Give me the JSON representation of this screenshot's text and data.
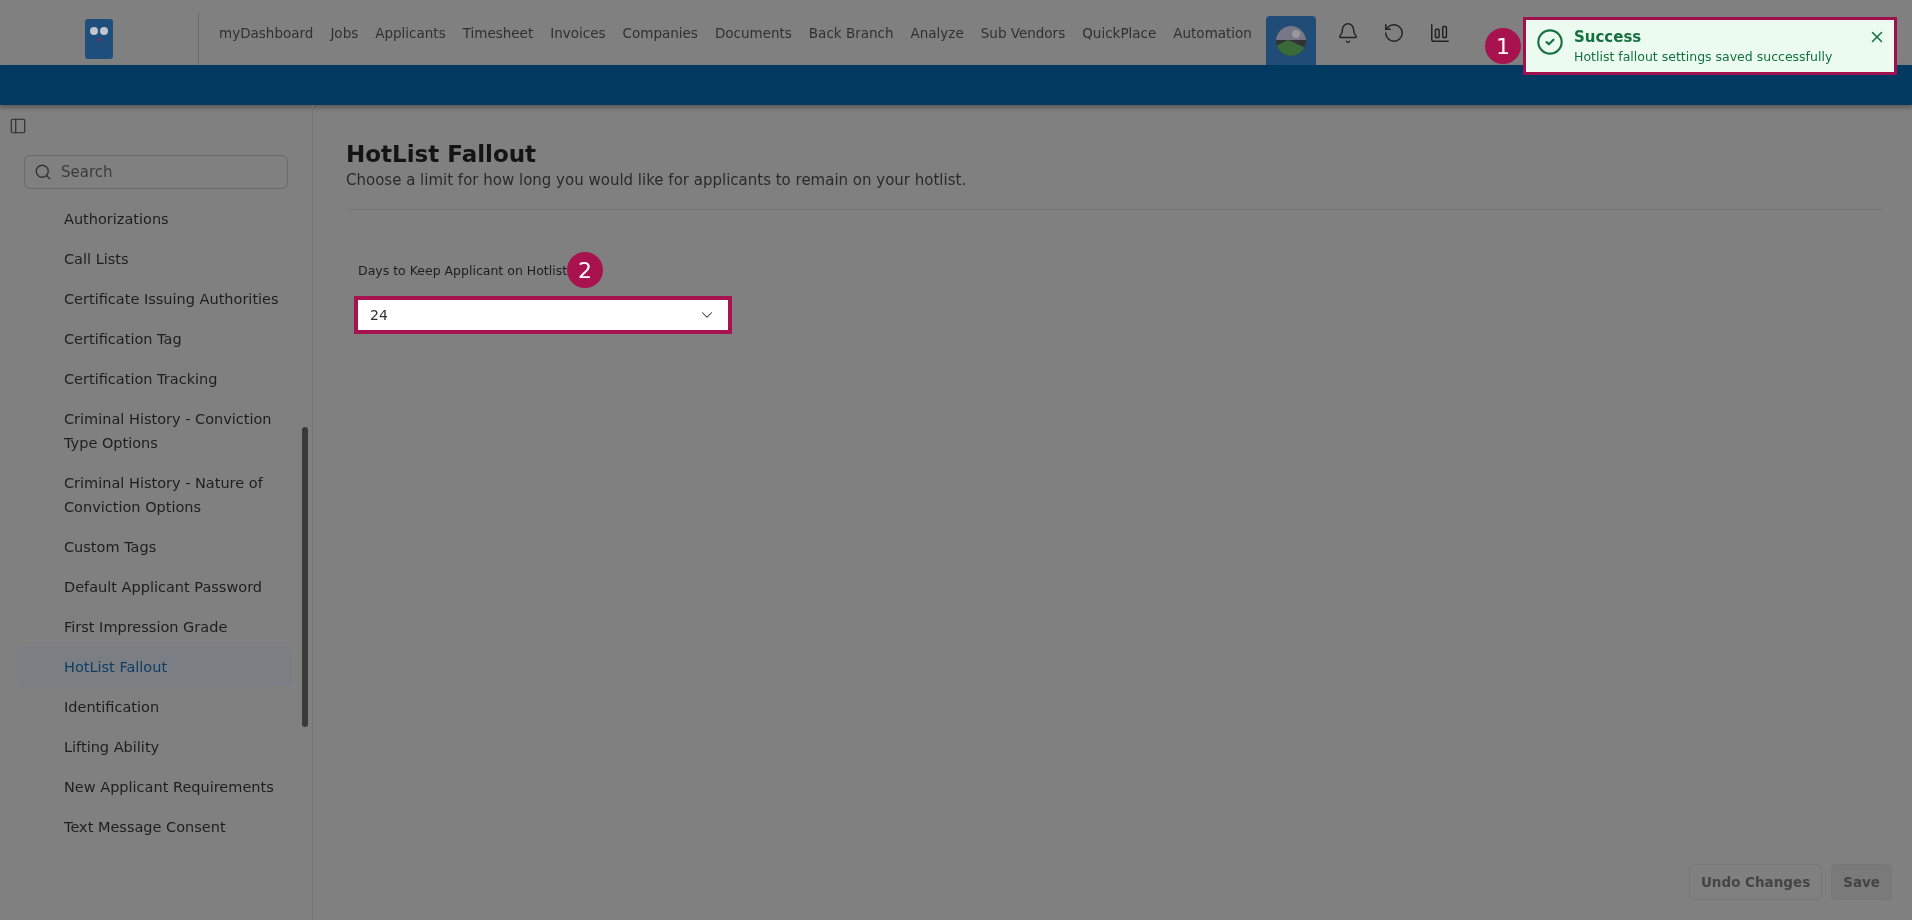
{
  "nav": {
    "items": [
      {
        "label": "myDashboard"
      },
      {
        "label": "Jobs"
      },
      {
        "label": "Applicants"
      },
      {
        "label": "Timesheet"
      },
      {
        "label": "Invoices"
      },
      {
        "label": "Companies"
      },
      {
        "label": "Documents"
      },
      {
        "label": "Back Branch"
      },
      {
        "label": "Analyze"
      },
      {
        "label": "Sub Vendors"
      },
      {
        "label": "QuickPlace"
      },
      {
        "label": "Automation"
      }
    ]
  },
  "toast": {
    "title": "Success",
    "message": "Hotlist fallout settings saved successfully",
    "badge": "1"
  },
  "sidebar": {
    "search": {
      "placeholder": "Search"
    },
    "items": [
      {
        "label": "Authorizations",
        "selected": false
      },
      {
        "label": "Call Lists",
        "selected": false
      },
      {
        "label": "Certificate Issuing Authorities",
        "selected": false
      },
      {
        "label": "Certification Tag",
        "selected": false
      },
      {
        "label": "Certification Tracking",
        "selected": false
      },
      {
        "label": "Criminal History - Conviction Type Options",
        "selected": false
      },
      {
        "label": "Criminal History - Nature of Conviction Options",
        "selected": false
      },
      {
        "label": "Custom Tags",
        "selected": false
      },
      {
        "label": "Default Applicant Password",
        "selected": false
      },
      {
        "label": "First Impression Grade",
        "selected": false
      },
      {
        "label": "HotList Fallout",
        "selected": true
      },
      {
        "label": "Identification",
        "selected": false
      },
      {
        "label": "Lifting Ability",
        "selected": false
      },
      {
        "label": "New Applicant Requirements",
        "selected": false
      },
      {
        "label": "Text Message Consent",
        "selected": false
      }
    ]
  },
  "content": {
    "title": "HotList Fallout",
    "description": "Choose a limit for how long you would like for applicants to remain on your hotlist.",
    "field": {
      "label": "Days to Keep Applicant on Hotlist",
      "value": "24",
      "badge": "2"
    },
    "buttons": [
      {
        "label": "Undo Changes"
      },
      {
        "label": "Save"
      }
    ]
  }
}
